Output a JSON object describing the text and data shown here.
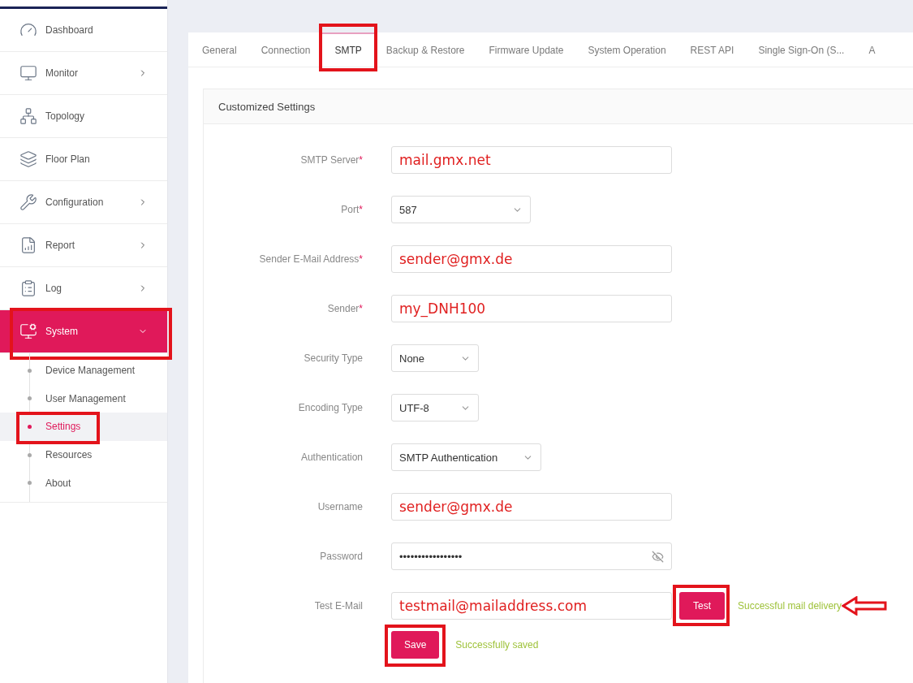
{
  "sidebar": {
    "items": [
      {
        "label": "Dashboard",
        "kind": "link",
        "selected": false,
        "highlighted": false
      },
      {
        "label": "Monitor",
        "kind": "menu",
        "expanded": false,
        "selected": false,
        "highlighted": false
      },
      {
        "label": "Topology",
        "kind": "link",
        "selected": false,
        "highlighted": false
      },
      {
        "label": "Floor Plan",
        "kind": "link",
        "selected": false,
        "highlighted": false
      },
      {
        "label": "Configuration",
        "kind": "menu",
        "expanded": false,
        "selected": false,
        "highlighted": false
      },
      {
        "label": "Report",
        "kind": "menu",
        "expanded": false,
        "selected": false,
        "highlighted": false
      },
      {
        "label": "Log",
        "kind": "menu",
        "expanded": false,
        "selected": false,
        "highlighted": false
      },
      {
        "label": "System",
        "kind": "menu",
        "expanded": true,
        "selected": true,
        "highlighted": true,
        "children": [
          {
            "label": "Device Management",
            "selected": false,
            "highlighted": false
          },
          {
            "label": "User Management",
            "selected": false,
            "highlighted": false
          },
          {
            "label": "Settings",
            "selected": true,
            "highlighted": true
          },
          {
            "label": "Resources",
            "selected": false,
            "highlighted": false
          },
          {
            "label": "About",
            "selected": false,
            "highlighted": false
          }
        ]
      }
    ]
  },
  "tabs": [
    {
      "label": "General",
      "selected": false,
      "highlighted": false
    },
    {
      "label": "Connection",
      "selected": false,
      "highlighted": false
    },
    {
      "label": "SMTP",
      "selected": true,
      "highlighted": true
    },
    {
      "label": "Backup & Restore",
      "selected": false,
      "highlighted": false
    },
    {
      "label": "Firmware Update",
      "selected": false,
      "highlighted": false
    },
    {
      "label": "System Operation",
      "selected": false,
      "highlighted": false
    },
    {
      "label": "REST API",
      "selected": false,
      "highlighted": false
    },
    {
      "label": "Single Sign-On (S...",
      "selected": false,
      "highlighted": false
    },
    {
      "label": "A",
      "selected": false,
      "highlighted": false
    }
  ],
  "card": {
    "title": "Customized Settings",
    "fields": [
      {
        "label": "SMTP Server",
        "required_mark": "*",
        "kind": "text",
        "value": "mail.gmx.net",
        "annotated": true
      },
      {
        "label": "Port",
        "required_mark": "*",
        "kind": "select",
        "value": "587",
        "annotated": false
      },
      {
        "label": "Sender E-Mail Address",
        "required_mark": "*",
        "kind": "text",
        "value": "sender@gmx.de",
        "annotated": true
      },
      {
        "label": "Sender",
        "required_mark": "*",
        "kind": "text",
        "value": "my_DNH100",
        "annotated": true
      },
      {
        "label": "Security Type",
        "kind": "select",
        "value": "None",
        "annotated": false
      },
      {
        "label": "Encoding Type",
        "kind": "select",
        "value": "UTF-8",
        "annotated": false
      },
      {
        "label": "Authentication",
        "kind": "select",
        "value": "SMTP Authentication",
        "annotated": false
      },
      {
        "label": "Username",
        "kind": "text",
        "value": "sender@gmx.de",
        "annotated": true
      },
      {
        "label": "Password",
        "kind": "password",
        "value": "•••••••••••••••••",
        "annotated": false
      },
      {
        "label": "Test E-Mail",
        "kind": "test",
        "value": "testmail@mailaddress.com",
        "annotated": true,
        "button": "Test",
        "button_highlighted": true,
        "message": "Successful mail delivery",
        "arrow": true
      }
    ],
    "save": {
      "label": "Save",
      "highlighted": true,
      "message": "Successfully saved"
    }
  }
}
